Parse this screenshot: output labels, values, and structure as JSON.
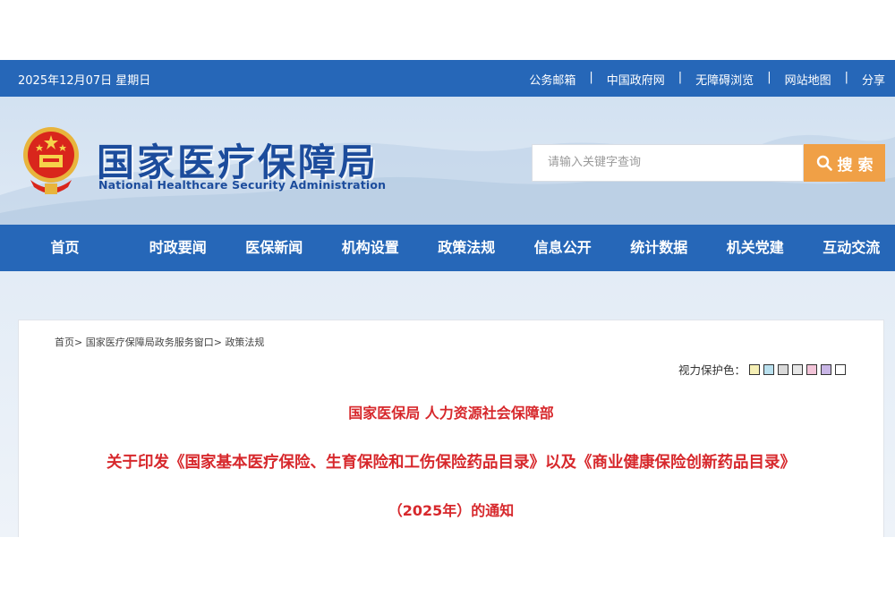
{
  "topbar": {
    "date": "2025年12月07日 星期日",
    "links": [
      "公务邮箱",
      "中国政府网",
      "无障碍浏览",
      "网站地图",
      "分享"
    ],
    "separator": "|"
  },
  "header": {
    "title": "国家医疗保障局",
    "subtitle": "National Healthcare Security Administration",
    "emblem_icon": "national-emblem-icon"
  },
  "search": {
    "placeholder": "请输入关键字查询",
    "button_label": "搜 索",
    "button_color": "#f0a046"
  },
  "nav": {
    "items": [
      "首页",
      "时政要闻",
      "医保新闻",
      "机构设置",
      "政策法规",
      "信息公开",
      "统计数据",
      "机关党建",
      "互动交流"
    ],
    "color": "#2667b8"
  },
  "breadcrumb": {
    "items": [
      "首页",
      "国家医疗保障局政务服务窗口",
      "政策法规"
    ],
    "separator": ">"
  },
  "eye_protection": {
    "label": "视力保护色：",
    "swatches": [
      "#f5efb5",
      "#b9e0ee",
      "#d9d9d9",
      "#e6e6e6",
      "#f2c4d8",
      "#c9b6e6",
      "#ffffff"
    ]
  },
  "article": {
    "line1": "国家医保局 人力资源社会保障部",
    "line2": "关于印发《国家基本医疗保险、生育保险和工伤保险药品目录》以及《商业健康保险创新药品目录》",
    "line3": "（2025年）的通知",
    "title_color": "#d7282c"
  }
}
